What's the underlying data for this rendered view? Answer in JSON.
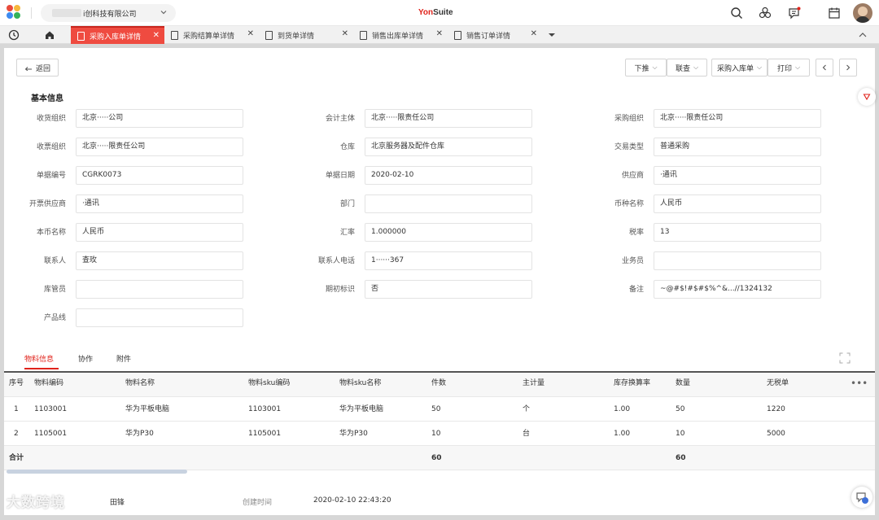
{
  "brand": {
    "prefix": "Yon",
    "suffix": "Suite",
    "prefix_color": "#e0231b"
  },
  "company": {
    "visible_text": "i创科技有限公司"
  },
  "icons": [
    "search-icon",
    "connect-icon",
    "message-icon",
    "calendar-icon",
    "history-icon",
    "home-icon",
    "close-icon",
    "document-icon",
    "chevron-down-icon",
    "chevron-up-icon",
    "back-icon",
    "chevron-left-icon",
    "chevron-right-icon",
    "share-icon",
    "expand-icon",
    "more-icon",
    "chat-icon"
  ],
  "tabs": [
    {
      "label": "采购入库单详情",
      "active": true
    },
    {
      "label": "采购结算单详情",
      "active": false
    },
    {
      "label": "到货单详情",
      "active": false
    },
    {
      "label": "销售出库单详情",
      "active": false
    },
    {
      "label": "销售订单详情",
      "active": false
    }
  ],
  "toolbar": {
    "back": "返回",
    "push_down": "下推",
    "linked_query": "联查",
    "purchase_receipt": "采购入库单",
    "print": "打印"
  },
  "section": {
    "basic_info": "基本信息"
  },
  "fields": [
    {
      "label": "收货组织",
      "value": "北京·····公司"
    },
    {
      "label": "会计主体",
      "value": "北京·····限责任公司"
    },
    {
      "label": "采购组织",
      "value": "北京·····限责任公司"
    },
    {
      "label": "收票组织",
      "value": "北京·····限责任公司"
    },
    {
      "label": "仓库",
      "value": "北京服务器及配件仓库"
    },
    {
      "label": "交易类型",
      "value": "普通采购"
    },
    {
      "label": "单据编号",
      "value": "CGRK0073"
    },
    {
      "label": "单据日期",
      "value": "2020-02-10"
    },
    {
      "label": "供应商",
      "value": "·通讯"
    },
    {
      "label": "开票供应商",
      "value": "·通讯"
    },
    {
      "label": "部门",
      "value": ""
    },
    {
      "label": "币种名称",
      "value": "人民币"
    },
    {
      "label": "本币名称",
      "value": "人民币"
    },
    {
      "label": "汇率",
      "value": "1.000000"
    },
    {
      "label": "税率",
      "value": "13"
    },
    {
      "label": "联系人",
      "value": "查玫"
    },
    {
      "label": "联系人电话",
      "value": "1······367"
    },
    {
      "label": "业务员",
      "value": ""
    },
    {
      "label": "库管员",
      "value": ""
    },
    {
      "label": "期初标识",
      "value": "否"
    },
    {
      "label": "备注",
      "value": "~@#$!#$#$%^&...//1324132"
    },
    {
      "label": "产品线",
      "value": ""
    }
  ],
  "subtabs": [
    {
      "label": "物料信息",
      "active": true
    },
    {
      "label": "协作",
      "active": false
    },
    {
      "label": "附件",
      "active": false
    }
  ],
  "table": {
    "columns": [
      "序号",
      "物料编码",
      "物料名称",
      "物料sku编码",
      "物料sku名称",
      "件数",
      "主计量",
      "库存换算率",
      "数量",
      "无税单"
    ],
    "rows": [
      [
        "1",
        "1103001",
        "华为平板电脑",
        "1103001",
        "华为平板电脑",
        "50",
        "个",
        "1.00",
        "50",
        "1220"
      ],
      [
        "2",
        "1105001",
        "华为P30",
        "1105001",
        "华为P30",
        "10",
        "台",
        "1.00",
        "10",
        "5000"
      ]
    ],
    "summary": {
      "label": "合计",
      "pieces": "60",
      "quantity": "60"
    }
  },
  "footer": {
    "creator_value": "田锋",
    "created_time_label": "创建时间",
    "created_time_value": "2020-02-10 22:43:20"
  },
  "watermark": "大数跨境",
  "colors": {
    "accent": "#e0231b",
    "active_tab": "#ef4b40"
  }
}
